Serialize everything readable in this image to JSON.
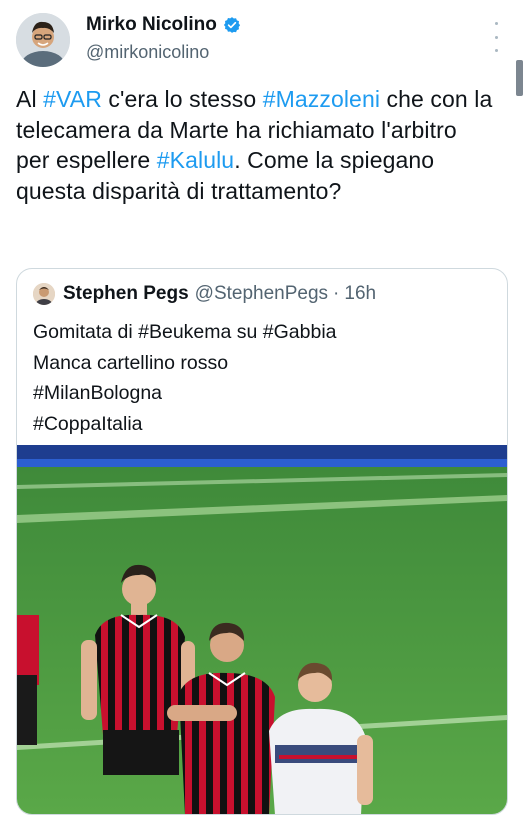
{
  "author": {
    "display_name": "Mirko Nicolino",
    "handle": "@mirkonicolino",
    "verified": true
  },
  "tweet": {
    "segments": [
      {
        "text": "Al ",
        "type": "text"
      },
      {
        "text": "#VAR",
        "type": "hashtag"
      },
      {
        "text": " c'era lo stesso ",
        "type": "text"
      },
      {
        "text": "#Mazzoleni",
        "type": "hashtag"
      },
      {
        "text": " che con la telecamera da Marte ha richiamato l'arbitro per espellere ",
        "type": "text"
      },
      {
        "text": "#Kalulu",
        "type": "hashtag"
      },
      {
        "text": ". Come la spiegano questa disparità di trattamento?",
        "type": "text"
      }
    ]
  },
  "quoted_tweet": {
    "display_name": "Stephen Pegs",
    "handle": "@StephenPegs",
    "separator": "·",
    "time": "16h",
    "lines": [
      "Gomitata di #Beukema su #Gabbia",
      "Manca cartellino rosso",
      "#MilanBologna",
      "#CoppaItalia"
    ]
  },
  "colors": {
    "hashtag": "#1d9bf0",
    "verified": "#1d9bf0",
    "pitch": "#4f9a3e",
    "milan_red": "#c8102e",
    "milan_black": "#111111"
  },
  "icons": {
    "verified": "verified-badge-icon",
    "more": "more-vertical-icon"
  }
}
